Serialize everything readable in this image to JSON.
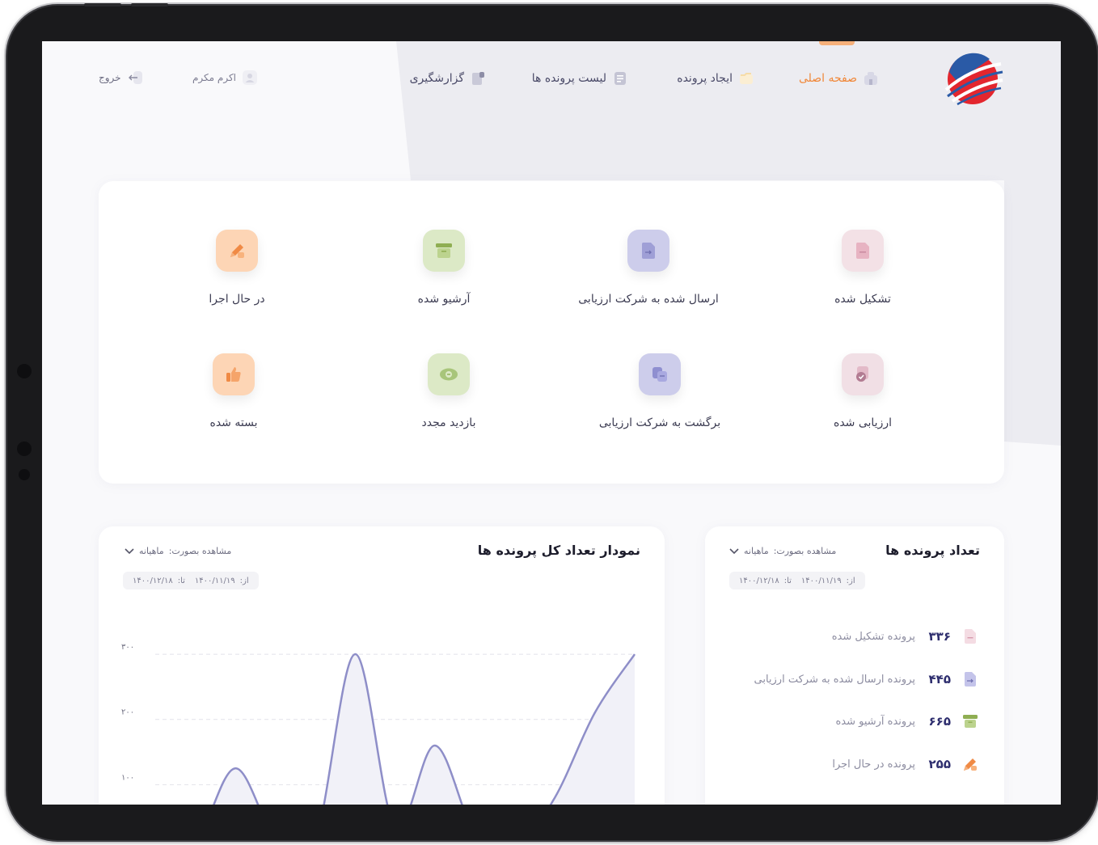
{
  "nav": {
    "items": [
      {
        "label": "صفحه اصلی",
        "icon": "home-icon"
      },
      {
        "label": "ایجاد پرونده",
        "icon": "folder-icon"
      },
      {
        "label": "لیست پرونده ها",
        "icon": "list-icon"
      },
      {
        "label": "گزارشگیری",
        "icon": "report-icon"
      }
    ],
    "active_color": "#f0883a"
  },
  "user": {
    "name": "اکرم مکرم"
  },
  "logout": {
    "label": "خروج"
  },
  "statuses": [
    {
      "label": "تشکیل شده",
      "color": "#f3e1e6",
      "icon": "document-icon"
    },
    {
      "label": "ارسال شده به شرکت ارزیابی",
      "color": "#cdcdeb",
      "icon": "send-document-icon"
    },
    {
      "label": "آرشیو شده",
      "color": "#dce9c6",
      "icon": "archive-icon"
    },
    {
      "label": "در حال اجرا",
      "color": "#fdd5b5",
      "icon": "edit-icon"
    },
    {
      "label": "ارزیابی شده",
      "color": "#f1dfe5",
      "icon": "approved-icon"
    },
    {
      "label": "برگشت به شرکت ارزیابی",
      "color": "#cdcdeb",
      "icon": "return-icon"
    },
    {
      "label": "بازدید مجدد",
      "color": "#dce9c6",
      "icon": "eye-icon"
    },
    {
      "label": "بسته شده",
      "color": "#fdd5b5",
      "icon": "thumb-up-icon"
    }
  ],
  "counts_panel": {
    "title": "تعداد پرونده ها",
    "view_label": "مشاهده بصورت:",
    "view_value": "ماهیانه",
    "from_label": "از:",
    "from_date": "۱۴۰۰/۱۱/۱۹",
    "to_label": "تا:",
    "to_date": "۱۴۰۰/۱۲/۱۸",
    "rows": [
      {
        "count": "۳۳۶",
        "label": "پرونده تشکیل شده",
        "icon": "document-icon"
      },
      {
        "count": "۴۴۵",
        "label": "پرونده ارسال شده به شرکت ارزیابی",
        "icon": "send-document-icon"
      },
      {
        "count": "۶۶۵",
        "label": "پرونده آرشیو شده",
        "icon": "archive-icon"
      },
      {
        "count": "۲۵۵",
        "label": "پرونده در حال اجرا",
        "icon": "edit-icon"
      }
    ]
  },
  "chart_panel": {
    "title": "نمودار تعداد کل پرونده ها",
    "view_label": "مشاهده بصورت:",
    "view_value": "ماهیانه",
    "from_label": "از:",
    "from_date": "۱۴۰۰/۱۱/۱۹",
    "to_label": "تا:",
    "to_date": "۱۴۰۰/۱۲/۱۸"
  },
  "chart_data": {
    "type": "area",
    "title": "",
    "xlabel": "",
    "ylabel": "",
    "y_ticks": [
      {
        "value": 100,
        "label": "۱۰۰"
      },
      {
        "value": 200,
        "label": "۲۰۰"
      },
      {
        "value": 300,
        "label": "۳۰۰"
      }
    ],
    "grid": true,
    "ylim": [
      0,
      310
    ],
    "x": [
      0,
      1,
      2,
      3,
      4,
      5,
      6,
      7,
      8,
      9,
      10,
      11,
      12
    ],
    "values": [
      0,
      10,
      125,
      20,
      15,
      300,
      35,
      160,
      25,
      0,
      80,
      210,
      300
    ],
    "line_color": "#8e8ec8",
    "fill_color": "#f1f1f8"
  }
}
